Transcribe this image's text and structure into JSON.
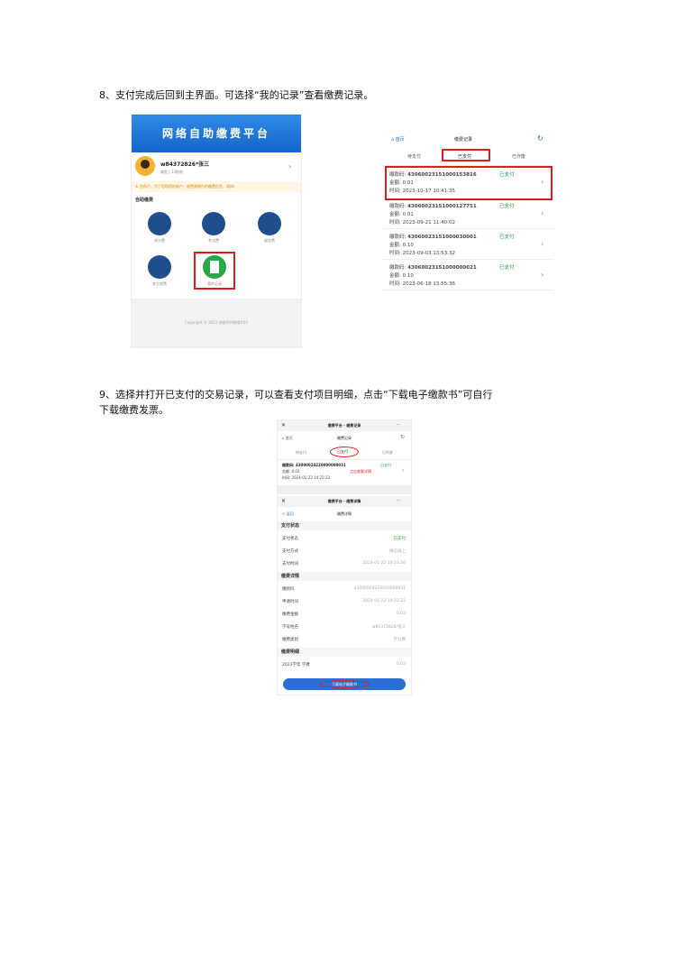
{
  "step8": {
    "text": "8、支付完成后回到主界面。可选择“我的记录”查看缴费记录。"
  },
  "step9": {
    "line1": "9、选择并打开已支付的交易记录，可以查看支付项目明细，点击“下载电子缴款书”可自行",
    "line2": "下载缴费发票。"
  },
  "app_main": {
    "banner_title": "网络自助缴费平台",
    "user_name": "w84372826*张三",
    "user_sub": "绑定 | 13秒前",
    "notice": "① 台用户，为了您和您的账户，收费周期内的缴费信息，请知！",
    "section_title": "自助缴费",
    "icons": [
      {
        "label": "学分费"
      },
      {
        "label": "考试费"
      },
      {
        "label": "留学费"
      },
      {
        "label": "其它收费"
      },
      {
        "label": "我的记录"
      }
    ],
    "copyright": "Copyright © 2023  湖南XXX教育XXX"
  },
  "records": {
    "back": "⌂ 首页",
    "title": "缴费记录",
    "tabs": [
      "待支付",
      "已支付",
      "已作废"
    ],
    "items": [
      {
        "no_label": "缴款码:",
        "no": "43060023151000153816",
        "amount": "金额: 0.01",
        "time": "时间: 2023-10-17 10:41:35",
        "status": "已支付"
      },
      {
        "no_label": "缴款码:",
        "no": "43060023151000127751",
        "amount": "金额: 0.01",
        "time": "时间: 2023-09-21 11:40:02",
        "status": "已支付"
      },
      {
        "no_label": "缴款码:",
        "no": "43060023151000030001",
        "amount": "金额: 0.10",
        "time": "时间: 2023-09-03 13:53:32",
        "status": "已支付"
      },
      {
        "no_label": "缴款码:",
        "no": "43060023151000000021",
        "amount": "金额: 0.10",
        "time": "时间: 2023-06-18 13:55:36",
        "status": "已支付"
      }
    ]
  },
  "detail": {
    "top_bar": "缴费平台 - 缴费记录",
    "close": "✕",
    "more": "···",
    "back": "⌂ 首页",
    "rec_title": "缴费记录",
    "tabs": [
      "待支付",
      "已支付",
      "已作废"
    ],
    "item": {
      "no": "缴款码: 43000024220000000031",
      "status": "已支付",
      "amount": "金额: 0.02",
      "time": "时间: 2024-01-22 14:22:22",
      "hint": "点击查看详情"
    },
    "bar2": "缴费平台 - 缴费详情",
    "back2": "< 返回",
    "detail_title": "缴费详情",
    "sections": [
      {
        "title": "支付状态",
        "rows": [
          {
            "label": "支付状态",
            "value": "已支付"
          },
          {
            "label": "支付方式",
            "value": "微信线上"
          },
          {
            "label": "支付时间",
            "value": "2024-01-22 14:23:16"
          }
        ]
      },
      {
        "title": "缴费详情",
        "rows": [
          {
            "label": "缴款码",
            "value": "43000024220000000031"
          },
          {
            "label": "申请时间",
            "value": "2024-01-22 14:22:22"
          },
          {
            "label": "缴费金额",
            "value": "0.02"
          },
          {
            "label": "学号姓名",
            "value": "w84372826/张三"
          },
          {
            "label": "缴费类别",
            "value": "学分费"
          }
        ]
      },
      {
        "title": "缴费明细",
        "rows": [
          {
            "label": "2023学年 学费",
            "value": "0.02"
          }
        ]
      }
    ],
    "download": "下载电子缴款书"
  },
  "colors": {
    "red": "#e31b1b",
    "blue": "#1565c8",
    "green": "#1a9e3a"
  }
}
